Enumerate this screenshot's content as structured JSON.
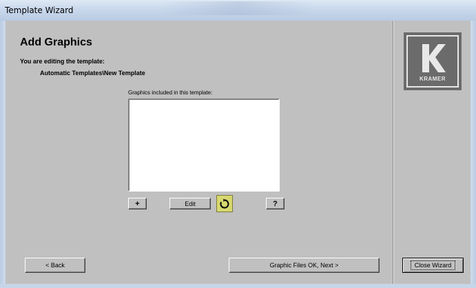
{
  "window": {
    "title": "Template Wizard"
  },
  "main": {
    "heading": "Add Graphics",
    "editing_label": "You are editing the template:",
    "template_path": "Automatic Templates\\New Template",
    "list_label": "Graphics included in this template:",
    "graphics": []
  },
  "toolbar": {
    "add_label": "+",
    "edit_label": "Edit",
    "help_label": "?",
    "refresh_icon": "refresh-icon"
  },
  "nav": {
    "back_label": "< Back",
    "next_label": "Graphic Files OK, Next >",
    "close_label": "Close Wizard"
  },
  "logo": {
    "text": "KRAMER"
  },
  "colors": {
    "dialog_bg": "#c0c0c0",
    "titlebar": "#c9d8ec",
    "refresh_bg": "#d8d870",
    "logo_bg": "#6b6b6b"
  }
}
